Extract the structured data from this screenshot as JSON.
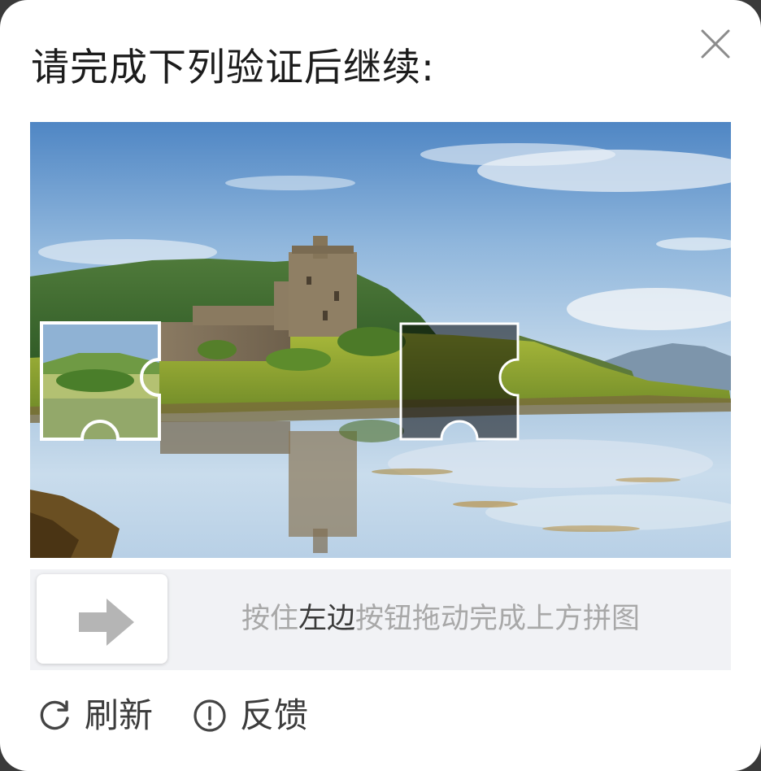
{
  "dialog": {
    "title": "请完成下列验证后继续:",
    "close_icon": "close-icon"
  },
  "slider": {
    "hint_prefix": "按住",
    "hint_emphasis": "左边",
    "hint_suffix": "按钮拖动完成上方拼图",
    "handle_icon": "arrow-right-icon"
  },
  "footer": {
    "refresh_label": "刷新",
    "feedback_label": "反馈"
  },
  "colors": {
    "hint_text": "#a8a8a8",
    "hint_emphasis": "#3a3a3a",
    "track_bg": "#f1f2f5",
    "arrow": "#b5b5b5"
  }
}
